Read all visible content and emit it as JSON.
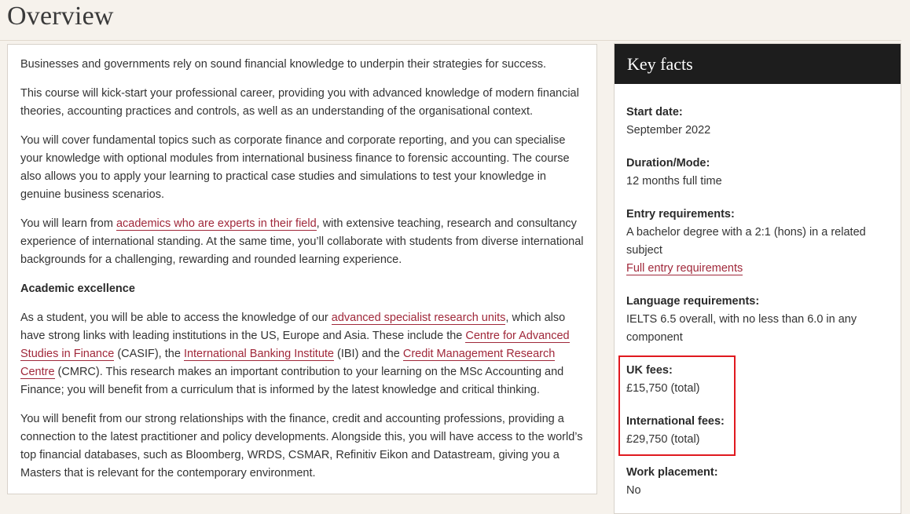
{
  "page": {
    "title": "Overview"
  },
  "overview": {
    "p1": "Businesses and governments rely on sound financial knowledge to underpin their strategies for success.",
    "p2": "This course will kick-start your professional career, providing you with advanced knowledge of modern financial theories, accounting practices and controls, as well as an understanding of the organisational context.",
    "p3": "You will cover fundamental topics such as corporate finance and corporate reporting, and you can specialise your knowledge with optional modules from international business finance to forensic accounting. The course also allows you to apply your learning to practical case studies and simulations to test your knowledge in genuine business scenarios.",
    "p4_before": "You will learn from ",
    "p4_link": "academics who are experts in their field",
    "p4_after": ", with extensive teaching, research and consultancy experience of international standing. At the same time, you’ll collaborate with students from diverse international backgrounds for a challenging, rewarding and rounded learning experience.",
    "subheading": "Academic excellence",
    "p5_before": "As a student, you will be able to access the knowledge of our ",
    "p5_link1": "advanced specialist research units",
    "p5_mid1": ", which also have strong links with leading institutions in the US, Europe and Asia. These include the ",
    "p5_link2": "Centre for Advanced Studies in Finance",
    "p5_mid2": " (CASIF), the ",
    "p5_link3": "International Banking Institute",
    "p5_mid3": " (IBI) and the ",
    "p5_link4": "Credit Management Research Centre",
    "p5_after": " (CMRC). This research makes an important contribution to your learning on the MSc Accounting and Finance; you will benefit from a curriculum that is informed by the latest knowledge and critical thinking.",
    "p6": "You will benefit from our strong relationships with the finance, credit and accounting professions, providing a connection to the latest practitioner and policy developments. Alongside this, you will have access to the world’s top financial databases, such as Bloomberg, WRDS, CSMAR, Refinitiv Eikon and Datastream, giving you a Masters that is relevant for the contemporary environment."
  },
  "key_facts": {
    "title": "Key facts",
    "start_date_label": "Start date:",
    "start_date_value": "September 2022",
    "duration_label": "Duration/Mode:",
    "duration_value": "12 months full time",
    "entry_label": "Entry requirements:",
    "entry_value": "A bachelor degree with a 2:1 (hons) in a related subject",
    "entry_link": "Full entry requirements",
    "language_label": "Language requirements:",
    "language_value": "IELTS 6.5 overall, with no less than 6.0 in any component",
    "uk_fees_label": "UK fees:",
    "uk_fees_value": "£15,750 (total)",
    "intl_fees_label": "International fees:",
    "intl_fees_value": "£29,750 (total)",
    "placement_label": "Work placement:",
    "placement_value": "No"
  },
  "colors": {
    "link": "#a0283a",
    "header_bg": "#1d1d1d",
    "highlight": "#e0191f",
    "page_bg": "#f6f2ec"
  }
}
